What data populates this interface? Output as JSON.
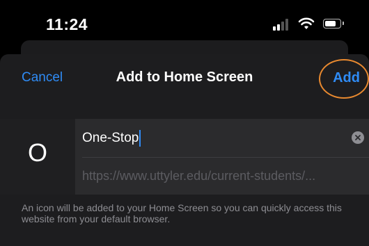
{
  "status_bar": {
    "time": "11:24",
    "icons": [
      "cellular-signal-icon",
      "wifi-icon",
      "battery-icon"
    ]
  },
  "nav": {
    "cancel_label": "Cancel",
    "title": "Add to Home Screen",
    "add_label": "Add"
  },
  "form": {
    "icon_letter": "O",
    "name_value": "One-Stop",
    "url": "https://www.uttyler.edu/current-students/..."
  },
  "help_text": "An icon will be added to your Home Screen so you can quickly access this website from your default browser.",
  "colors": {
    "accent": "#2f8cf6",
    "highlight_ring": "#e8892f",
    "sheet_background": "#1d1d1f",
    "field_background": "#2b2b2d"
  }
}
